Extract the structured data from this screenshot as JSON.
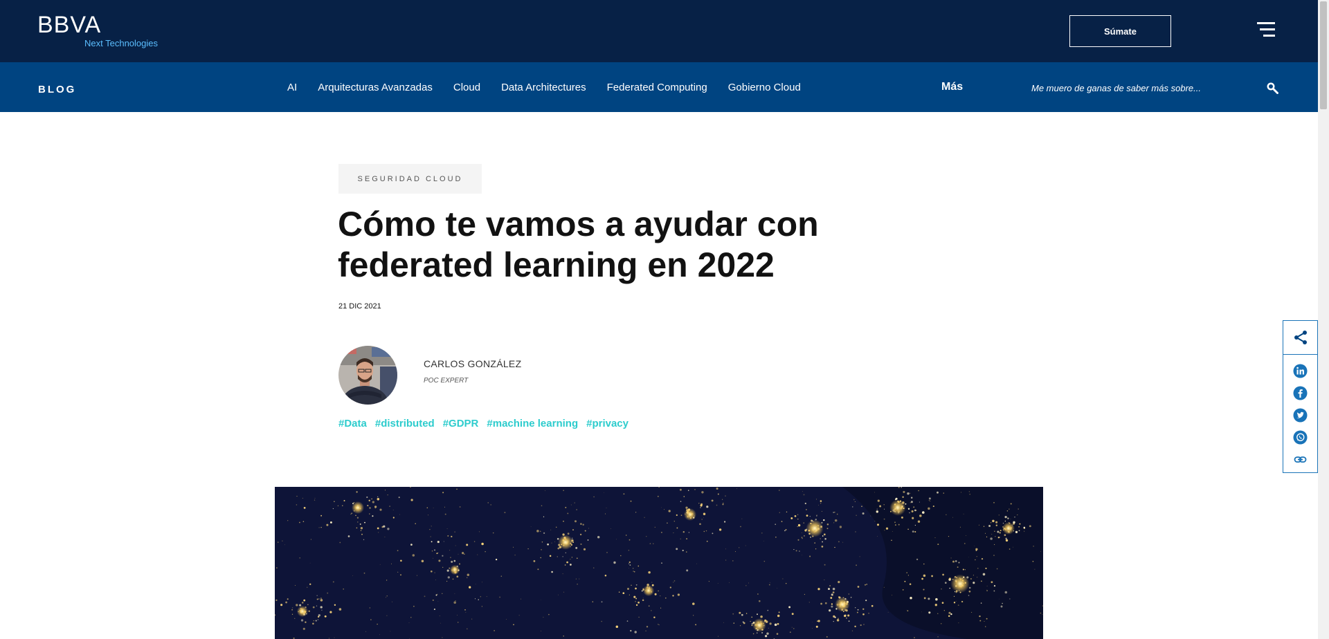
{
  "header": {
    "logo_text": "BBVA",
    "logo_subtitle": "Next Technologies",
    "join_label": "Súmate",
    "menu_icon": "hamburger-menu-icon"
  },
  "nav": {
    "blog_label": "BLOG",
    "items": [
      {
        "label": "AI"
      },
      {
        "label": "Arquitecturas Avanzadas"
      },
      {
        "label": "Cloud"
      },
      {
        "label": "Data Architectures"
      },
      {
        "label": "Federated Computing"
      },
      {
        "label": "Gobierno Cloud"
      }
    ],
    "more_label": "Más",
    "search_placeholder": "Me muero de ganas de saber más sobre...",
    "search_icon": "search-icon"
  },
  "article": {
    "category": "SEGURIDAD CLOUD",
    "title": "Cómo te vamos a ayudar con federated learning en 2022",
    "date": "21 DIC 2021",
    "author": {
      "name": "CARLOS GONZÁLEZ",
      "role": "POC EXPERT"
    },
    "tags": [
      "#Data",
      "#distributed",
      "#GDPR",
      "#machine learning",
      "#privacy"
    ]
  },
  "share": {
    "icons": [
      "share-icon",
      "linkedin-icon",
      "facebook-icon",
      "twitter-icon",
      "whatsapp-icon",
      "link-icon"
    ]
  },
  "colors": {
    "header_bg": "#072146",
    "nav_bg": "#004481",
    "tag_color": "#2dcccd",
    "accent_blue": "#1973b8"
  }
}
